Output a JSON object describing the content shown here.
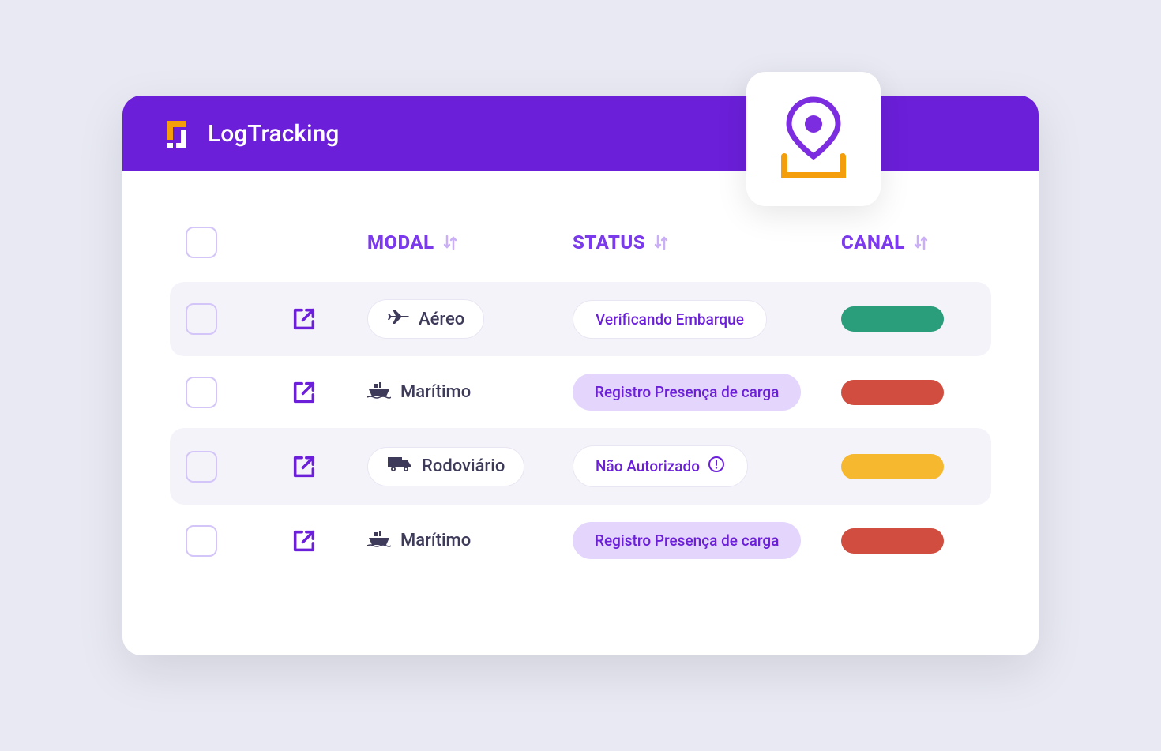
{
  "header": {
    "title": "LogTracking"
  },
  "columns": {
    "modal": "MODAL",
    "status": "STATUS",
    "canal": "CANAL"
  },
  "rows": [
    {
      "modal": "Aéreo",
      "modal_icon": "plane",
      "modal_style": "pill",
      "status": "Verificando Embarque",
      "status_style": "white",
      "has_alert": false,
      "canal": "green",
      "highlighted": true
    },
    {
      "modal": "Marítimo",
      "modal_icon": "ship",
      "modal_style": "text",
      "status": "Registro Presença de carga",
      "status_style": "purple",
      "has_alert": false,
      "canal": "red",
      "highlighted": false
    },
    {
      "modal": "Rodoviário",
      "modal_icon": "truck",
      "modal_style": "pill",
      "status": "Não Autorizado",
      "status_style": "white",
      "has_alert": true,
      "canal": "yellow",
      "highlighted": true
    },
    {
      "modal": "Marítimo",
      "modal_icon": "ship",
      "modal_style": "text",
      "status": "Registro Presença de carga",
      "status_style": "purple",
      "has_alert": false,
      "canal": "red",
      "highlighted": false
    }
  ]
}
